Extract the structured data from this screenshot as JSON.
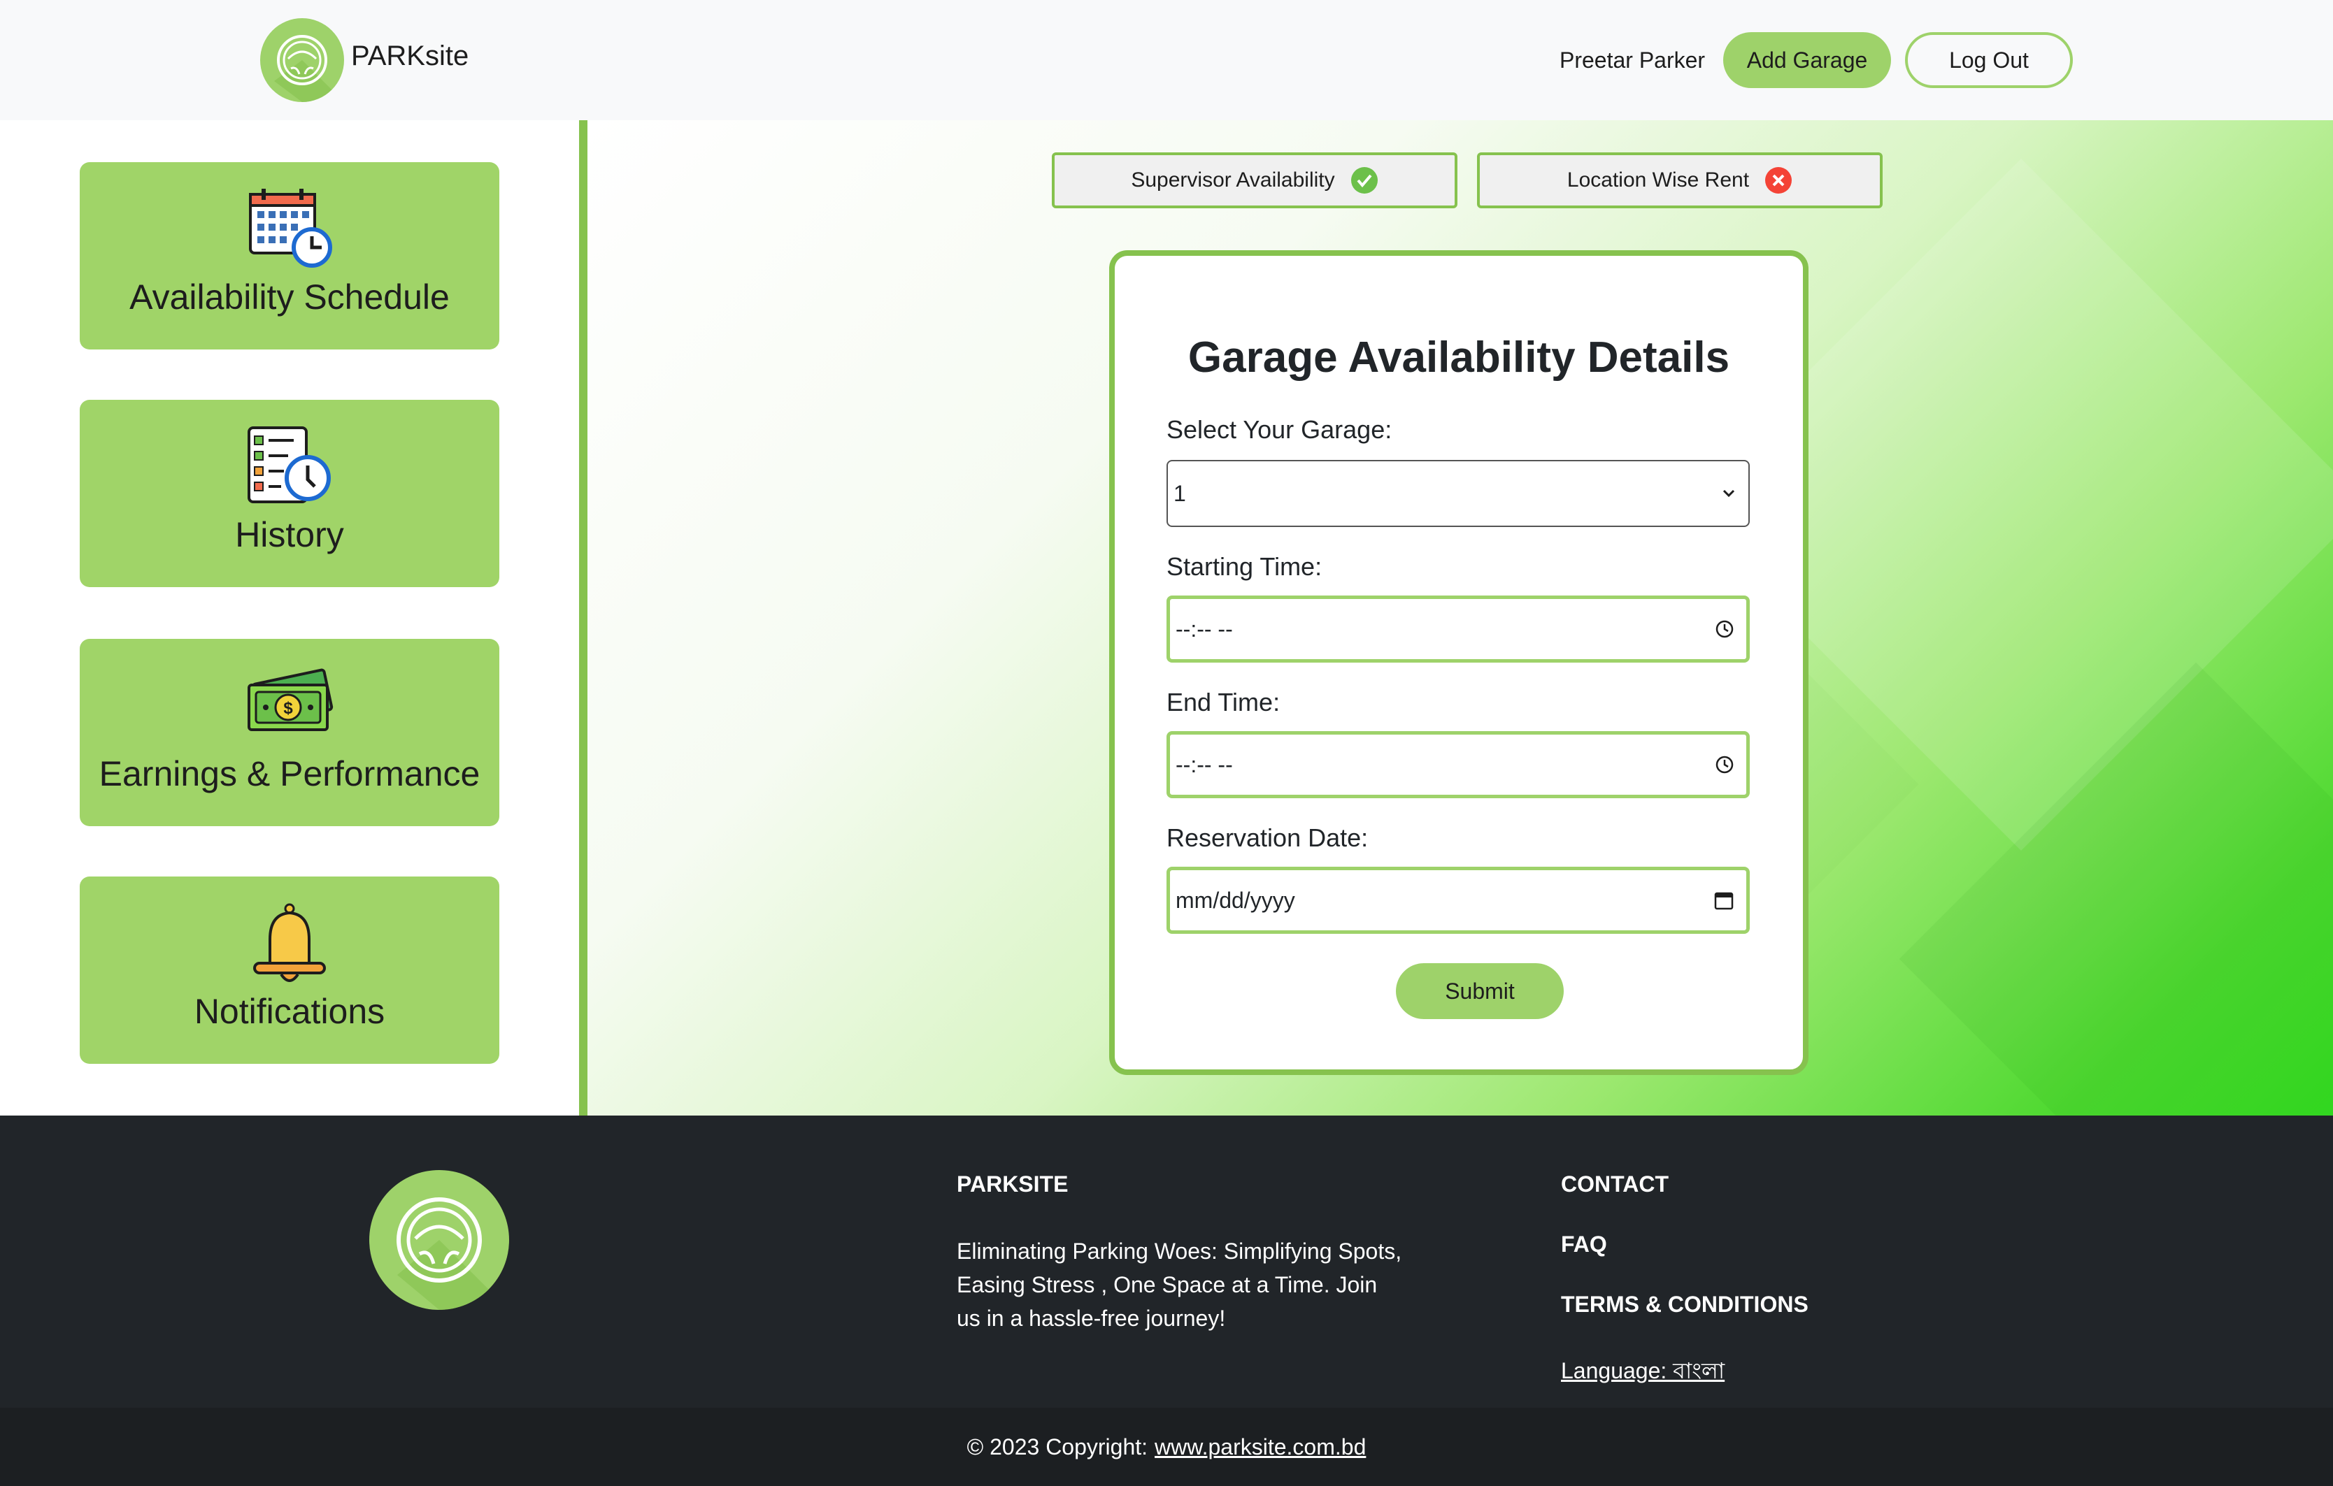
{
  "header": {
    "brand": "PARKsite",
    "user_name": "Preetar Parker",
    "add_garage_label": "Add Garage",
    "logout_label": "Log Out"
  },
  "sidebar": {
    "items": [
      {
        "label": "Availability Schedule",
        "icon": "calendar-clock-icon"
      },
      {
        "label": "History",
        "icon": "checklist-clock-icon"
      },
      {
        "label": "Earnings & Performance",
        "icon": "money-icon"
      },
      {
        "label": "Notifications",
        "icon": "bell-icon"
      }
    ]
  },
  "tabs": {
    "supervisor": {
      "label": "Supervisor Availability",
      "status": "check"
    },
    "location_rent": {
      "label": "Location Wise Rent",
      "status": "cross"
    }
  },
  "form": {
    "title": "Garage Availability Details",
    "garage_label": "Select Your Garage:",
    "garage_value": "1",
    "start_label": "Starting Time:",
    "start_placeholder": "--:-- --",
    "end_label": "End Time:",
    "end_placeholder": "--:-- --",
    "date_label": "Reservation Date:",
    "date_placeholder": "mm/dd/yyyy",
    "submit_label": "Submit"
  },
  "footer": {
    "brand_heading": "PARKSITE",
    "tagline": "Eliminating Parking Woes: Simplifying Spots, Easing Stress , One Space at a Time. Join us in a hassle-free journey!",
    "contact_label": "CONTACT",
    "faq_label": "FAQ",
    "terms_label": "TERMS & CONDITIONS",
    "language_label": "Language: বাংলা",
    "copyright_prefix": "© 2023 Copyright:",
    "copyright_link": "www.parksite.com.bd"
  },
  "colors": {
    "accent": "#9ed26a",
    "accent_dark": "#86c24e",
    "footer_bg": "#212529",
    "success": "#5cb85c",
    "danger": "#f44336"
  }
}
